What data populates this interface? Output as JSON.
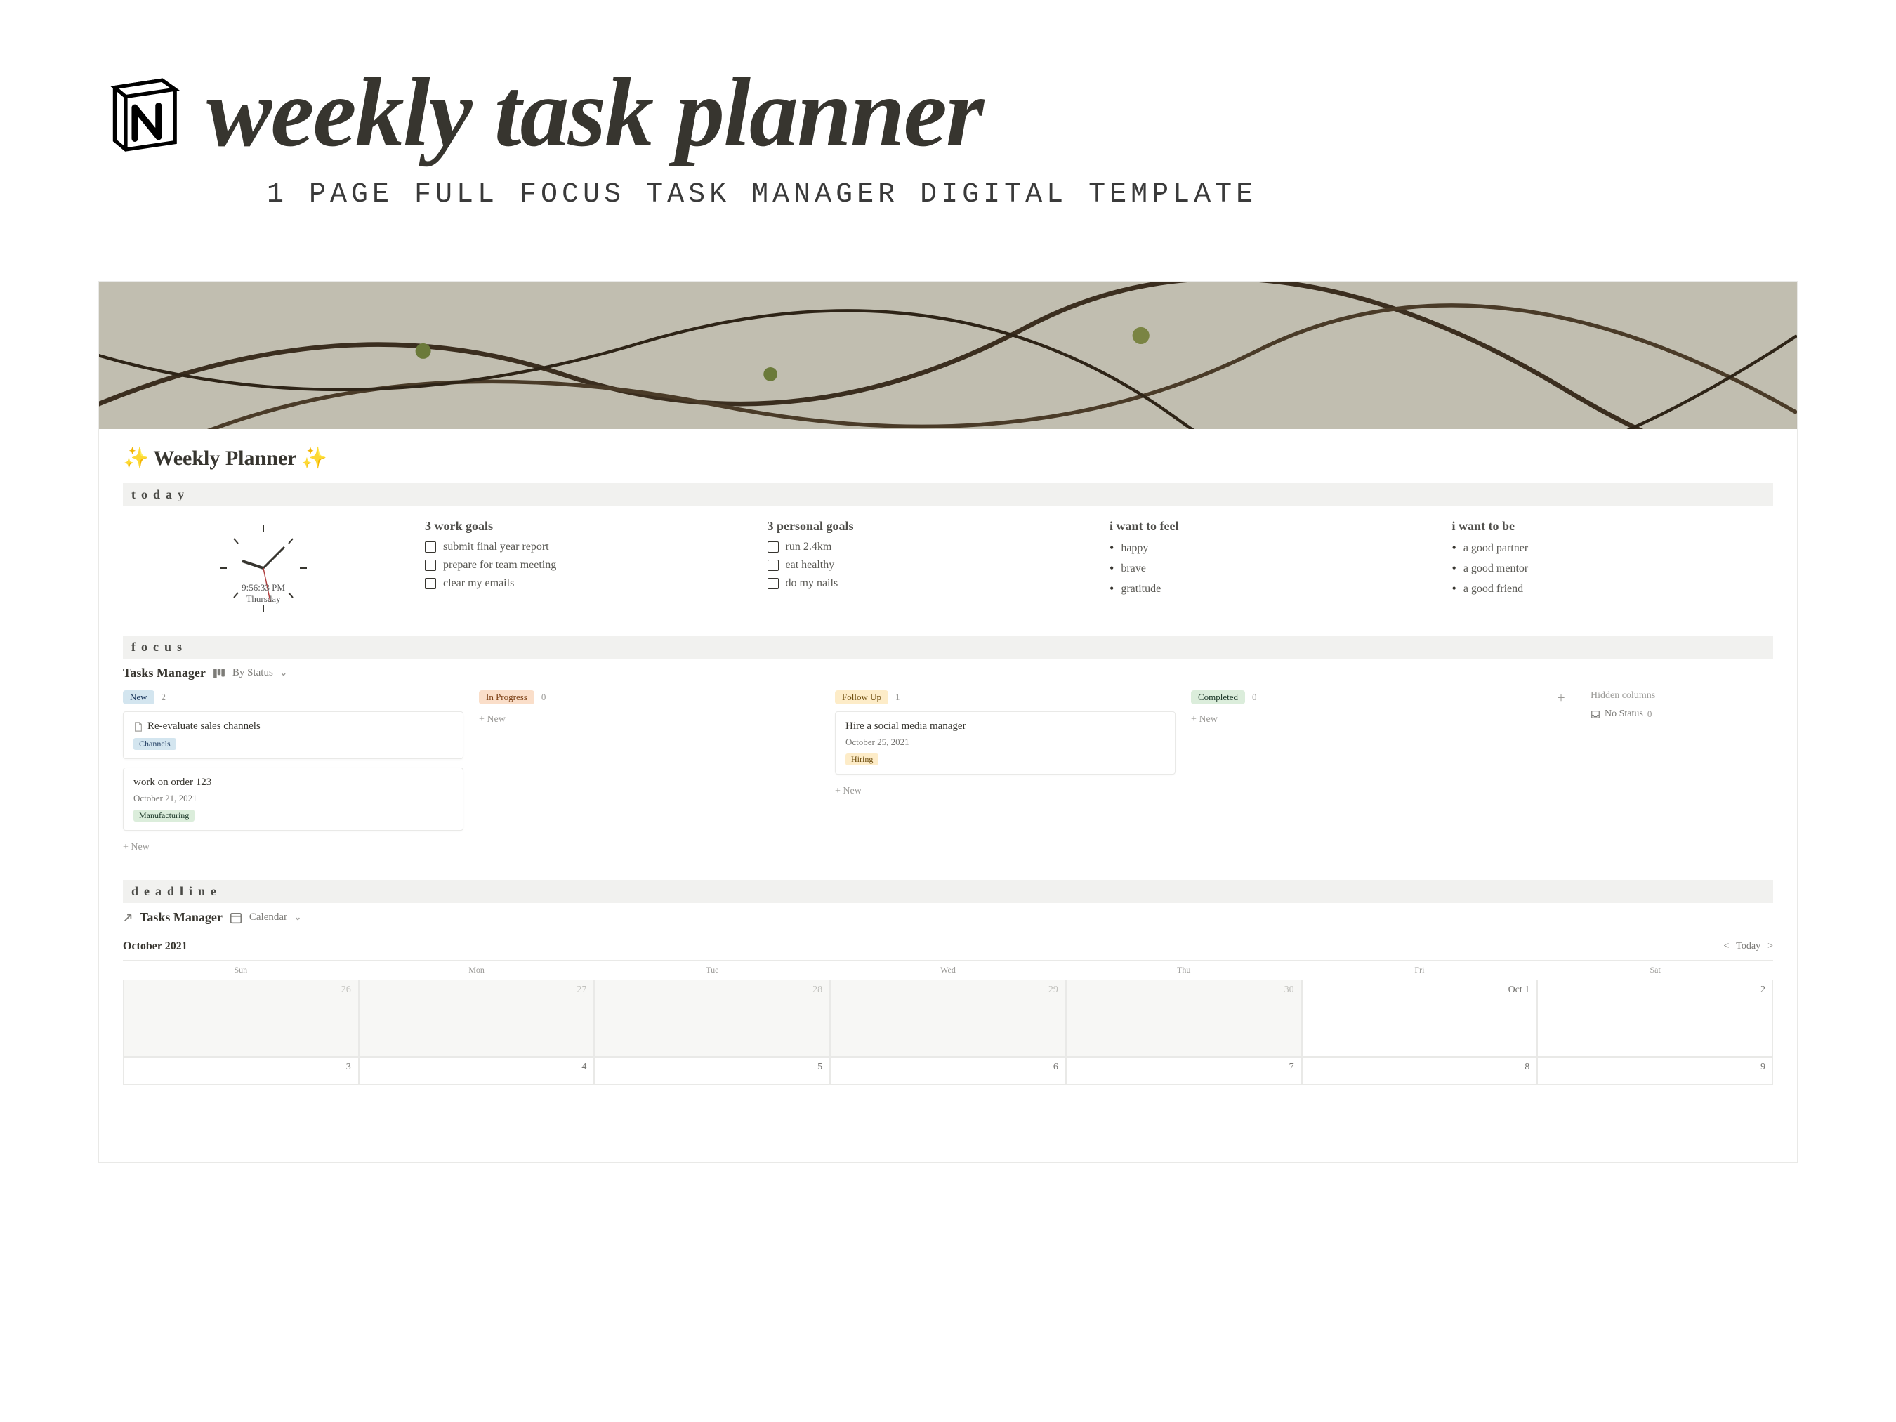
{
  "hero": {
    "title": "weekly task planner",
    "subtitle": "1 PAGE FULL FOCUS TASK MANAGER DIGITAL TEMPLATE"
  },
  "page_title": "Weekly Planner",
  "sections": {
    "today": "today",
    "focus": "focus",
    "deadline": "deadline"
  },
  "clock": {
    "time": "9:56:33 PM",
    "day": "Thursday"
  },
  "today_cols": {
    "work": {
      "heading": "3 work goals",
      "items": [
        "submit final year report",
        "prepare for team meeting",
        "clear my emails"
      ]
    },
    "personal": {
      "heading": "3 personal goals",
      "items": [
        "run 2.4km",
        "eat healthy",
        "do my nails"
      ]
    },
    "feel": {
      "heading": "i want to feel",
      "items": [
        "happy",
        "brave",
        "gratitude"
      ]
    },
    "be": {
      "heading": "i want to be",
      "items": [
        "a good partner",
        "a good mentor",
        "a good friend"
      ]
    }
  },
  "tasks_db": {
    "title": "Tasks Manager",
    "view": "By Status",
    "columns": [
      {
        "label": "New",
        "count": "2",
        "pill": "pill-blue",
        "cards": [
          {
            "title": "Re-evaluate sales channels",
            "date": "",
            "tag": "Channels",
            "tag_class": "tag-blue",
            "has_icon": true
          },
          {
            "title": "work on order 123",
            "date": "October 21, 2021",
            "tag": "Manufacturing",
            "tag_class": "tag-green",
            "has_icon": false
          }
        ]
      },
      {
        "label": "In Progress",
        "count": "0",
        "pill": "pill-orange",
        "cards": []
      },
      {
        "label": "Follow Up",
        "count": "1",
        "pill": "pill-yellow",
        "cards": [
          {
            "title": "Hire a social media manager",
            "date": "October 25, 2021",
            "tag": "Hiring",
            "tag_class": "tag-yellow",
            "has_icon": false
          }
        ]
      },
      {
        "label": "Completed",
        "count": "0",
        "pill": "pill-green",
        "cards": []
      }
    ],
    "hidden_label": "Hidden columns",
    "hidden_item": "No Status",
    "hidden_count": "0",
    "new_label": "+  New"
  },
  "deadline_db": {
    "title": "Tasks Manager",
    "view": "Calendar",
    "month": "October 2021",
    "today_label": "Today",
    "day_headers": [
      "Sun",
      "Mon",
      "Tue",
      "Wed",
      "Thu",
      "Fri",
      "Sat"
    ],
    "rows": [
      [
        {
          "n": "26",
          "out": true
        },
        {
          "n": "27",
          "out": true
        },
        {
          "n": "28",
          "out": true
        },
        {
          "n": "29",
          "out": true
        },
        {
          "n": "30",
          "out": true
        },
        {
          "n": "Oct 1",
          "out": false
        },
        {
          "n": "2",
          "out": false
        }
      ],
      [
        {
          "n": "3",
          "out": false
        },
        {
          "n": "4",
          "out": false
        },
        {
          "n": "5",
          "out": false
        },
        {
          "n": "6",
          "out": false
        },
        {
          "n": "7",
          "out": false
        },
        {
          "n": "8",
          "out": false
        },
        {
          "n": "9",
          "out": false
        }
      ]
    ]
  }
}
